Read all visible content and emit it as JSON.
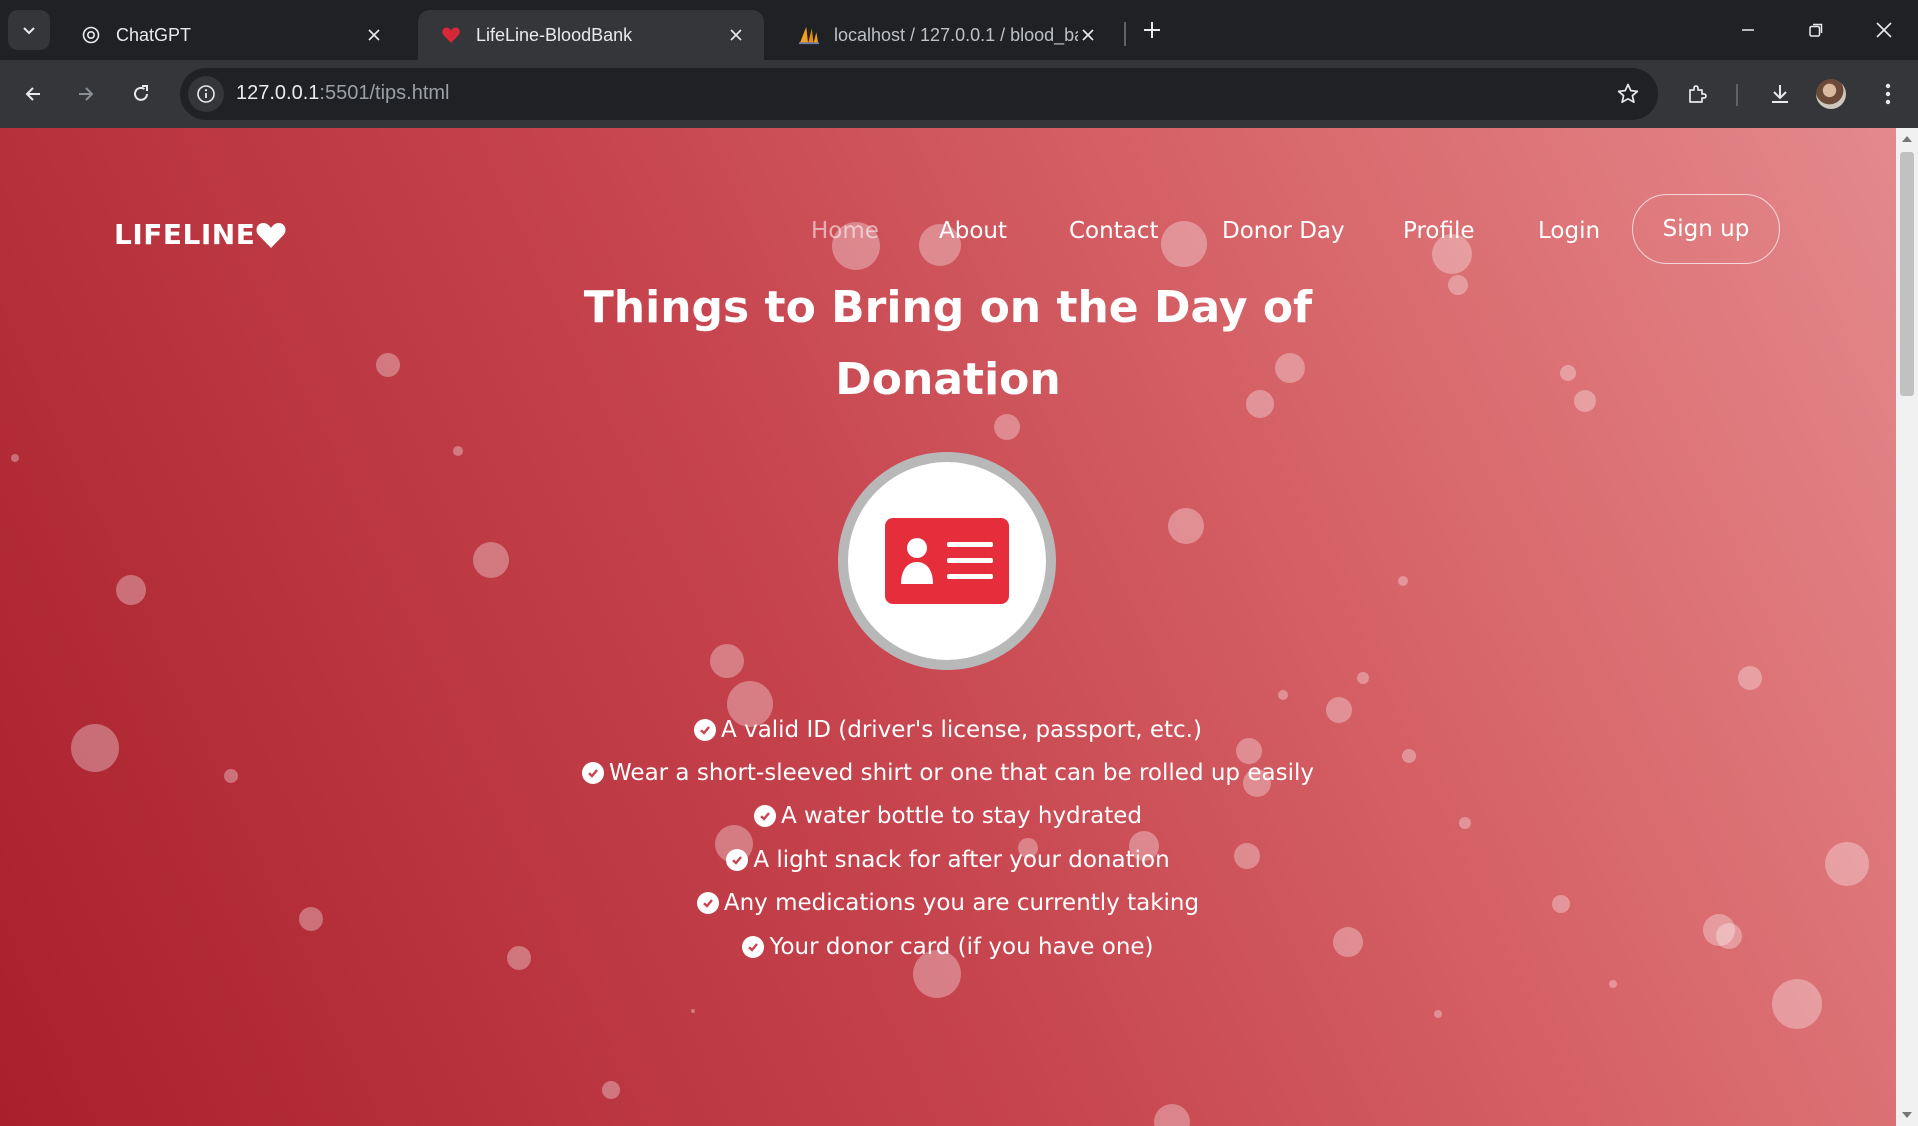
{
  "browser": {
    "tabs": [
      {
        "title": "ChatGPT",
        "icon": "chatgpt-logo-icon"
      },
      {
        "title": "LifeLine-BloodBank",
        "icon": "heart-icon",
        "active": true
      },
      {
        "title": "localhost / 127.0.0.1 / blood_ba",
        "icon": "phpmyadmin-sail-icon"
      }
    ],
    "url_host": "127.0.0.1",
    "url_path": ":5501/tips.html"
  },
  "page": {
    "logo": "LIFELINE",
    "nav": {
      "home": "Home",
      "about": "About",
      "contact": "Contact",
      "donor_day": "Donor Day",
      "profile": "Profile",
      "login": "Login",
      "signup": "Sign up"
    },
    "heading_line1": "Things to Bring on the Day of",
    "heading_line2": "Donation",
    "items": [
      "A valid ID (driver's license, passport, etc.)",
      "Wear a short-sleeved shirt or one that can be rolled up easily",
      "A water bottle to stay hydrated",
      "A light snack for after your donation",
      "Any medications you are currently taking",
      "Your donor card (if you have one)"
    ],
    "colors": {
      "accent": "#e52d3c",
      "background_start": "#a8202c",
      "background_end": "#e4898c"
    }
  }
}
